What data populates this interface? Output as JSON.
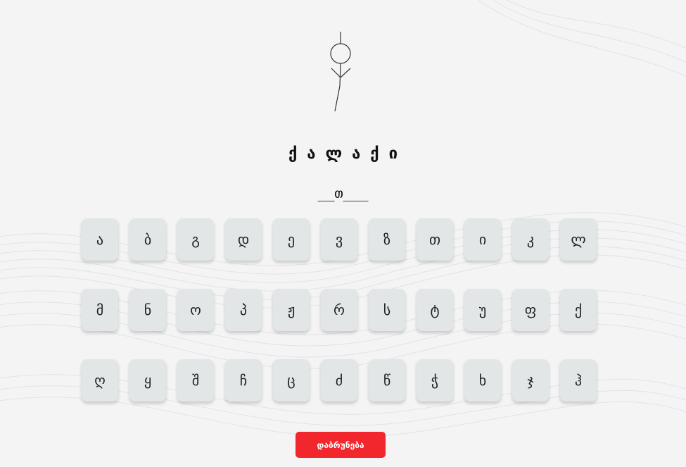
{
  "guessed_letters": [
    "ქ",
    "ა",
    "ლ",
    "ა",
    "ქ",
    "ი"
  ],
  "word_slots": [
    "_",
    "_",
    "თ",
    "_",
    "_",
    "_"
  ],
  "keyboard": {
    "rows": [
      [
        "ა",
        "ბ",
        "გ",
        "დ",
        "ე",
        "ვ",
        "ზ",
        "თ",
        "ი",
        "კ",
        "ლ"
      ],
      [
        "მ",
        "ნ",
        "ო",
        "პ",
        "ჟ",
        "რ",
        "ს",
        "ტ",
        "უ",
        "ფ",
        "ქ"
      ],
      [
        "ღ",
        "ყ",
        "შ",
        "ჩ",
        "ც",
        "ძ",
        "წ",
        "ჭ",
        "ხ",
        "ჯ",
        "ჰ"
      ]
    ]
  },
  "restart_button": "დაბრუნება",
  "colors": {
    "restart_button_bg": "#f2262d",
    "key_bg": "#e3e6e6",
    "background": "#f4f4f5"
  },
  "icons": {
    "hangman": "hangman-figure-icon"
  }
}
